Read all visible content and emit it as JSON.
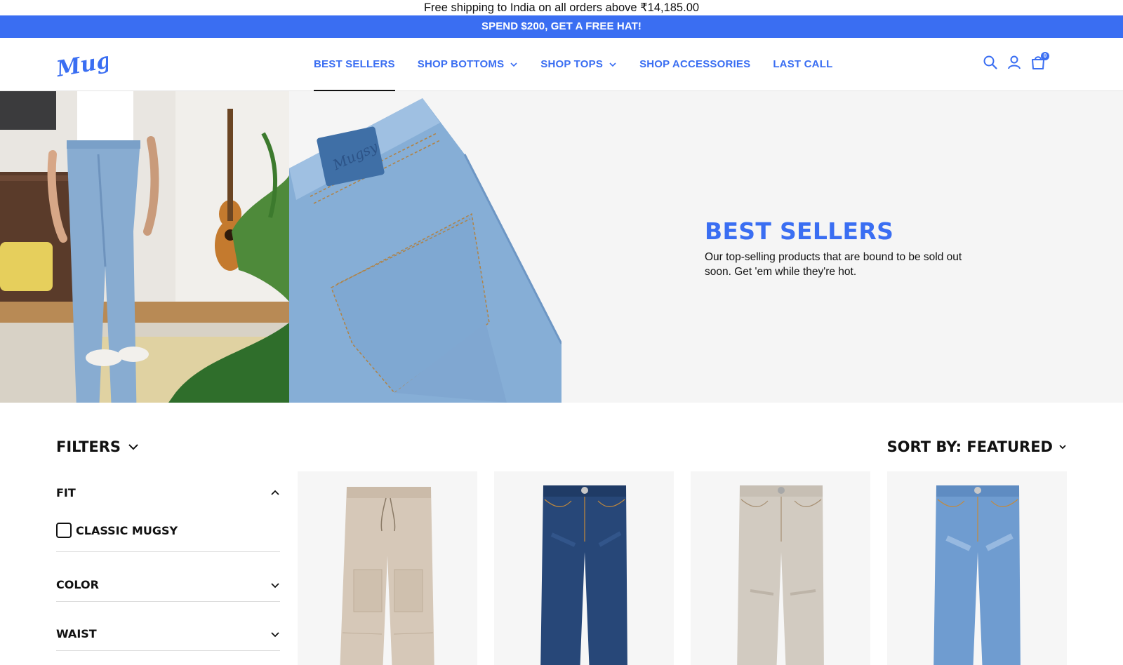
{
  "announcement": {
    "shipping_text": "Free shipping to India on all orders above ₹14,185.00",
    "promo_text": "SPEND $200, GET A FREE HAT!"
  },
  "header": {
    "logo_text": "Mugsy",
    "nav": [
      {
        "label": "BEST SELLERS",
        "has_dropdown": false,
        "active": true
      },
      {
        "label": "SHOP BOTTOMS",
        "has_dropdown": true,
        "active": false
      },
      {
        "label": "SHOP TOPS",
        "has_dropdown": true,
        "active": false
      },
      {
        "label": "SHOP ACCESSORIES",
        "has_dropdown": false,
        "active": false
      },
      {
        "label": "LAST CALL",
        "has_dropdown": false,
        "active": false
      }
    ],
    "icons": [
      "search-icon",
      "account-icon",
      "cart-icon"
    ],
    "cart_count": "0"
  },
  "hero": {
    "patch_text": "Mugsy",
    "title": "BEST SELLERS",
    "description": "Our top-selling products that are bound to be sold out soon. Get 'em while they're hot."
  },
  "collection": {
    "filters_label": "FILTERS",
    "sort_label": "SORT BY: FEATURED",
    "facets": [
      {
        "label": "FIT",
        "expanded": true,
        "options": [
          "CLASSIC MUGSY"
        ]
      },
      {
        "label": "COLOR",
        "expanded": false
      },
      {
        "label": "WAIST",
        "expanded": false
      }
    ]
  },
  "products": [
    {
      "color_name": "khaki jogger",
      "fabric_hex": "#d6c8b8"
    },
    {
      "color_name": "dark wash denim",
      "fabric_hex": "#274778"
    },
    {
      "color_name": "stone denim",
      "fabric_hex": "#d2cbc1"
    },
    {
      "color_name": "light wash denim",
      "fabric_hex": "#6f9cd0"
    }
  ],
  "colors": {
    "brand_blue": "#3a6ef2",
    "text": "#111111",
    "hero_bg": "#f5f5f5",
    "card_bg": "#f6f6f6"
  }
}
